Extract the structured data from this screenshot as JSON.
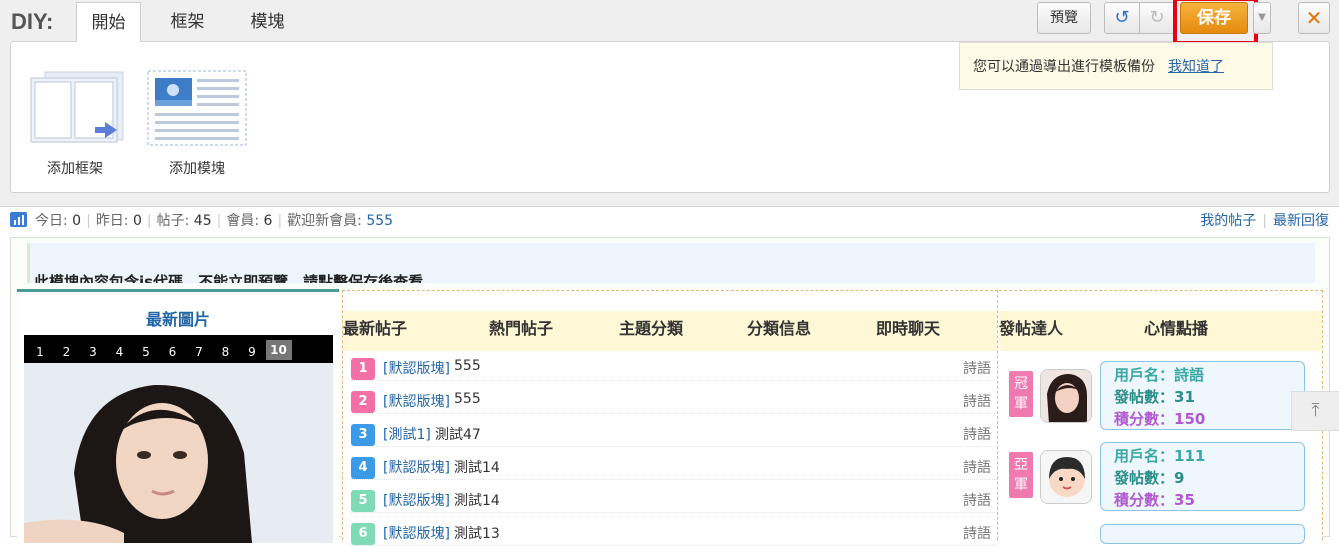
{
  "diy": {
    "label": "DIY:",
    "tabs": [
      "開始",
      "框架",
      "模塊"
    ],
    "tools": [
      {
        "label": "添加框架",
        "icon": "add-frame-icon"
      },
      {
        "label": "添加模塊",
        "icon": "add-block-icon"
      }
    ],
    "buttons": {
      "preview": "預覽",
      "undo_icon": "undo-icon",
      "redo_icon": "redo-icon",
      "save": "保存",
      "close_icon": "close-icon"
    },
    "tip": {
      "text": "您可以通過導出進行模板備份",
      "dismiss": "我知道了"
    }
  },
  "stats": {
    "today_label": "今日:",
    "today": "0",
    "yesterday_label": "昨日:",
    "yesterday": "0",
    "posts_label": "帖子:",
    "posts": "45",
    "members_label": "會員:",
    "members": "6",
    "welcome_label": "歡迎新會員:",
    "welcome_member": "555",
    "links": [
      "我的帖子",
      "最新回復"
    ]
  },
  "notice": "此模塊內容包含js代碼，不能立即預覽，請點擊保存後查看",
  "latest_pics": {
    "title": "最新圖片",
    "pages": [
      "1",
      "2",
      "3",
      "4",
      "5",
      "6",
      "7",
      "8",
      "9",
      "10"
    ],
    "active_page": "10"
  },
  "thread_tabs": [
    "最新帖子",
    "熱門帖子",
    "主題分類",
    "分類信息",
    "即時聊天"
  ],
  "threads": [
    {
      "rank": "1",
      "category": "[默認版塊]",
      "title": "555",
      "author": "詩語"
    },
    {
      "rank": "2",
      "category": "[默認版塊]",
      "title": "555",
      "author": "詩語"
    },
    {
      "rank": "3",
      "category": "[測試1]",
      "title": "測試47",
      "author": "詩語"
    },
    {
      "rank": "4",
      "category": "[默認版塊]",
      "title": "測試14",
      "author": "詩語"
    },
    {
      "rank": "5",
      "category": "[默認版塊]",
      "title": "測試14",
      "author": "詩語"
    },
    {
      "rank": "6",
      "category": "[默認版塊]",
      "title": "測試13",
      "author": "詩語"
    }
  ],
  "rank_colors": [
    "#f46fa6",
    "#f46fa6",
    "#3c9be8",
    "#3c9be8",
    "#7fdbb6",
    "#7fdbb6"
  ],
  "right_tabs": [
    "發帖達人",
    "心情點播"
  ],
  "top_posters": [
    {
      "badge": "冠軍",
      "name_label": "用戶名：",
      "name": "詩語",
      "posts_label": "發帖數：",
      "posts": "31",
      "credits_label": "積分數：",
      "credits": "150"
    },
    {
      "badge": "亞軍",
      "name_label": "用戶名：",
      "name": "111",
      "posts_label": "發帖數：",
      "posts": "9",
      "credits_label": "積分數：",
      "credits": "35"
    }
  ]
}
